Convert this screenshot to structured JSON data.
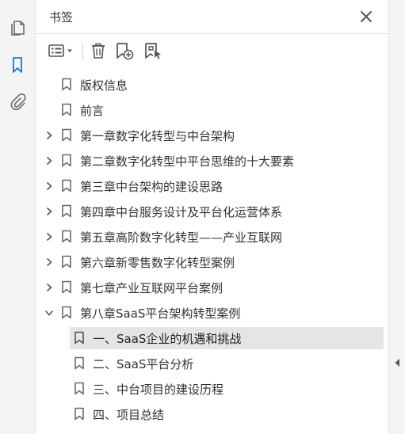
{
  "panel": {
    "title": "书签"
  },
  "left_rail": {
    "icons": [
      "pages-icon",
      "bookmarks-icon",
      "attachments-icon"
    ],
    "active": "bookmarks-icon"
  },
  "toolbar": {
    "icons": [
      "options-menu-icon",
      "delete-bookmark-icon",
      "new-bookmark-icon",
      "new-bookmark-from-structure-icon"
    ]
  },
  "colors": {
    "accent": "#1473e6",
    "icon_gray": "#6a6a6a",
    "selected_bg": "#e5e5e5"
  },
  "bookmarks": [
    {
      "label": "版权信息",
      "level": 0,
      "expandable": false
    },
    {
      "label": "前言",
      "level": 0,
      "expandable": false
    },
    {
      "label": "第一章数字化转型与中台架构",
      "level": 0,
      "expandable": true,
      "expanded": false
    },
    {
      "label": "第二章数字化转型中平台思维的十大要素",
      "level": 0,
      "expandable": true,
      "expanded": false
    },
    {
      "label": "第三章中台架构的建设思路",
      "level": 0,
      "expandable": true,
      "expanded": false
    },
    {
      "label": "第四章中台服务设计及平台化运营体系",
      "level": 0,
      "expandable": true,
      "expanded": false
    },
    {
      "label": "第五章高阶数字化转型——产业互联网",
      "level": 0,
      "expandable": true,
      "expanded": false
    },
    {
      "label": "第六章新零售数字化转型案例",
      "level": 0,
      "expandable": true,
      "expanded": false
    },
    {
      "label": "第七章产业互联网平台案例",
      "level": 0,
      "expandable": true,
      "expanded": false
    },
    {
      "label": "第八章SaaS平台架构转型案例",
      "level": 0,
      "expandable": true,
      "expanded": true
    },
    {
      "label": "一、SaaS企业的机遇和挑战",
      "level": 1,
      "expandable": false,
      "selected": true
    },
    {
      "label": "二、SaaS平台分析",
      "level": 1,
      "expandable": false
    },
    {
      "label": "三、中台项目的建设历程",
      "level": 1,
      "expandable": false
    },
    {
      "label": "四、项目总结",
      "level": 1,
      "expandable": false
    }
  ]
}
